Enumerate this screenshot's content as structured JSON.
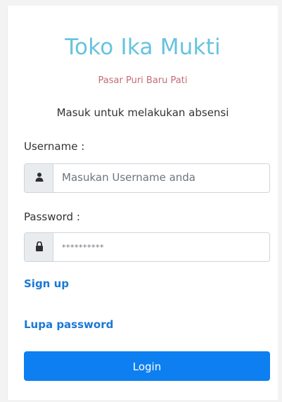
{
  "brand": {
    "title": "Toko Ika Mukti",
    "subtitle": "Pasar Puri Baru Pati"
  },
  "intro": "Masuk untuk melakukan absensi",
  "username": {
    "label": "Username :",
    "placeholder": "Masukan Username anda",
    "icon": "user-icon"
  },
  "password": {
    "label": "Password :",
    "value": "**********",
    "icon": "lock-icon"
  },
  "links": {
    "signup": "Sign up",
    "forgot": "Lupa password"
  },
  "button": {
    "login": "Login"
  },
  "colors": {
    "title": "#67c3de",
    "subtitle": "#c46c78",
    "link": "#1b78d6",
    "button": "#0d7ff0"
  }
}
